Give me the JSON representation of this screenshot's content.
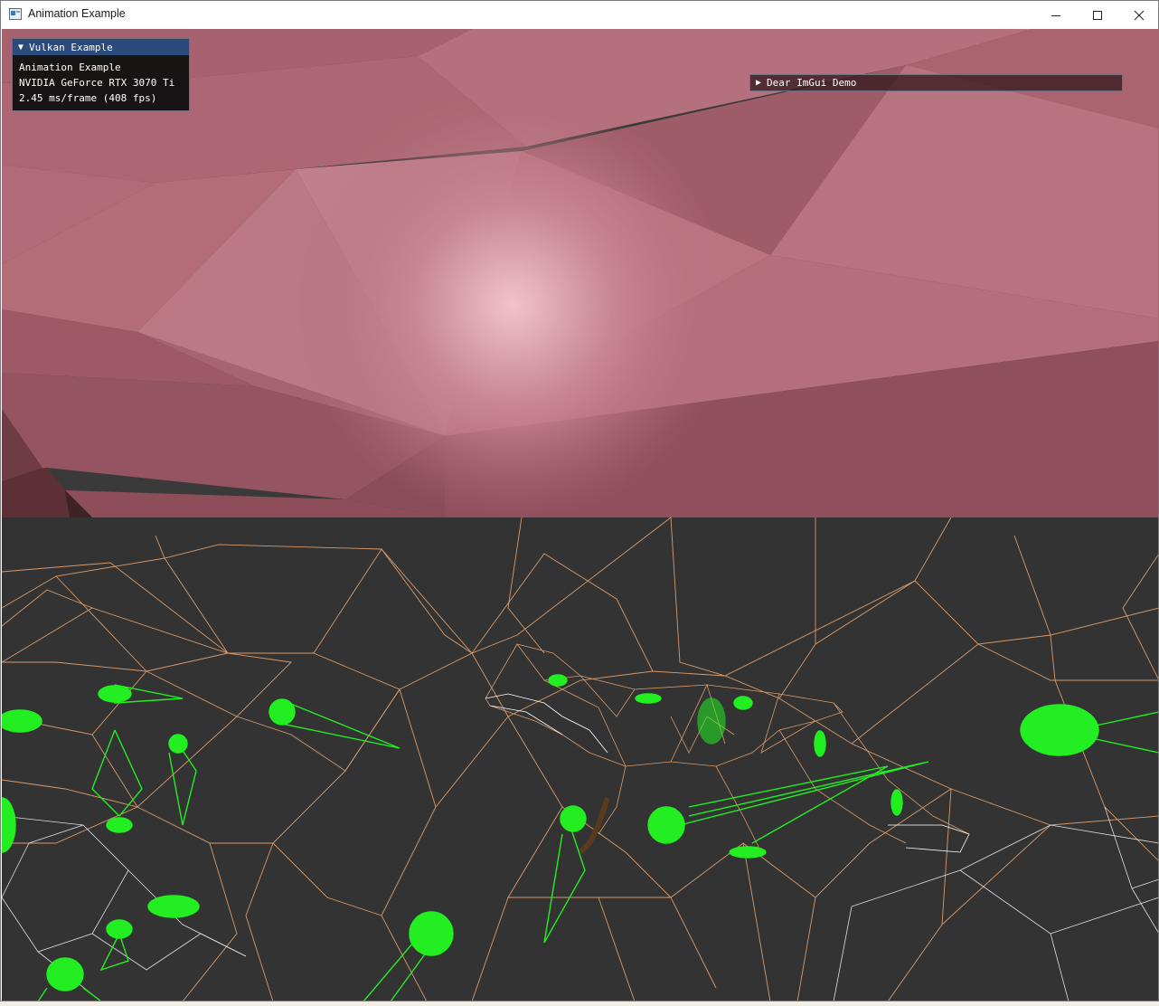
{
  "window": {
    "title": "Animation Example",
    "controls": {
      "minimize": "minimize-icon",
      "maximize": "maximize-icon",
      "close": "close-icon"
    }
  },
  "overlay": {
    "title": "Vulkan Example",
    "lines": [
      "Animation Example",
      "NVIDIA GeForce RTX 3070 Ti",
      "2.45 ms/frame (408 fps)"
    ],
    "collapse_icon": "triangle-down-icon"
  },
  "demo_window": {
    "label": "Dear ImGui Demo",
    "expand_icon": "triangle-right-icon"
  },
  "colors": {
    "titlebar_bg": "#ffffff",
    "imgui_title_bg": "#294a7a",
    "viewport_bg": "#333333",
    "mesh_pink": "#b76e7c",
    "wire_orange": "#d99a6a",
    "wire_white": "#ffffff",
    "bone_green": "#22ee22"
  }
}
